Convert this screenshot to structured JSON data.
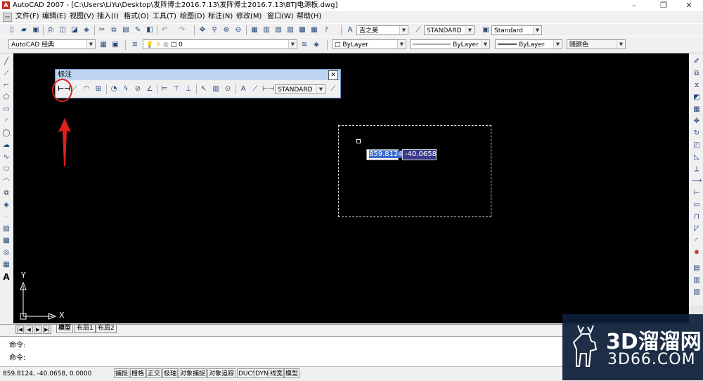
{
  "window": {
    "title": "AutoCAD 2007 - [C:\\Users\\LiYu\\Desktop\\发阵博士2016.7.13\\发阵博士2016.7.13\\BTJ电源板.dwg]",
    "controls": [
      "–",
      "❐",
      "✕"
    ]
  },
  "menu": [
    "文件(F)",
    "编辑(E)",
    "视图(V)",
    "插入(I)",
    "格式(O)",
    "工具(T)",
    "绘图(D)",
    "标注(N)",
    "修改(M)",
    "窗口(W)",
    "帮助(H)"
  ],
  "toolbar1": {
    "font_combo": "吉之美",
    "dimstyle_combo": "STANDARD",
    "textstyle_combo": "Standard"
  },
  "toolbar2": {
    "workspace_combo": "AutoCAD 经典",
    "layer_combo": "0",
    "color_combo": "ByLayer",
    "linetype_combo": "ByLayer",
    "lineweight_combo": "ByLayer",
    "plotstyle_combo": "随颜色"
  },
  "dimension_toolbar": {
    "title": "标注",
    "close": "✕",
    "style_combo": "STANDARD"
  },
  "dynamic_input": {
    "x_value": "859.8124",
    "y_value": "-40.0658"
  },
  "ucs": {
    "x_label": "X",
    "y_label": "Y"
  },
  "layout_tabs": {
    "nav": [
      "|◀",
      "◀",
      "▶",
      "▶|"
    ],
    "tabs": [
      "模型",
      "布局1",
      "布局2"
    ],
    "active": "模型"
  },
  "command_lines": [
    "命令:",
    "命令:"
  ],
  "status": {
    "coords": "859.8124,  -40.0658, 0.0000",
    "buttons": [
      "捕捉",
      "栅格",
      "正交",
      "极轴",
      "对象捕捉",
      "对象追踪",
      "DUCS",
      "DYN",
      "线宽",
      "模型"
    ]
  },
  "watermark": {
    "line1": "3D溜溜网",
    "line2": "3D66.COM"
  },
  "colors": {
    "canvas": "#000000",
    "annotation_red": "#e02020",
    "dyn_input_bg": "#3a3a8a"
  }
}
